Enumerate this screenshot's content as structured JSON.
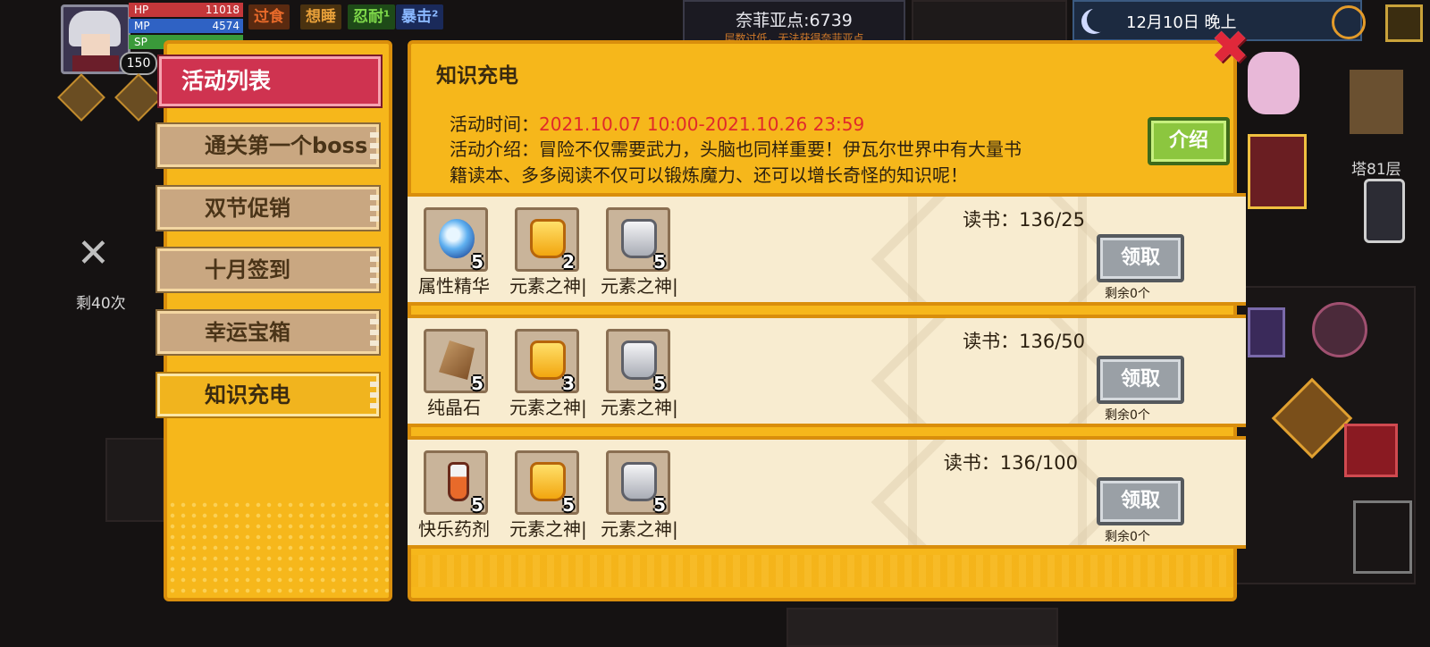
{
  "hud": {
    "level": "150",
    "stats": [
      {
        "label": "HP",
        "value": "11018",
        "color": "#d43a3a"
      },
      {
        "label": "MP",
        "value": "4574",
        "color": "#2f6fd6"
      },
      {
        "label": "SP",
        "value": "",
        "color": "#3aa53a"
      }
    ],
    "status_tags": [
      {
        "label": "过食",
        "color": "#e05a2a",
        "bg": "#5a2a10"
      },
      {
        "label": "想睡",
        "color": "#e9a13a",
        "bg": "#4a3210"
      },
      {
        "label": "忍耐¹",
        "color": "#7fd94a",
        "bg": "#1e4a18"
      },
      {
        "label": "暴击²",
        "color": "#8ab8ff",
        "bg": "#1a2a5a"
      }
    ],
    "nephi_points": "奈菲亚点:6739",
    "nephi_notice": "层数过低，无法获得奈菲亚点",
    "date": "12月10日  晚上",
    "floor": "塔81层",
    "remaining_uses": "剩40次"
  },
  "sidebar": {
    "header": "活动列表",
    "tabs": [
      {
        "label": "通关第一个boss"
      },
      {
        "label": "双节促销"
      },
      {
        "label": "十月签到"
      },
      {
        "label": "幸运宝箱"
      },
      {
        "label": "知识充电"
      }
    ]
  },
  "event": {
    "title": "知识充电",
    "time_label": "活动时间：",
    "time_value": "2021.10.07 10:00-2021.10.26 23:59",
    "intro_line1": "活动介绍：冒险不仅需要武力，头脑也同样重要！伊瓦尔世界中有大量书",
    "intro_line2": "籍读本、多多阅读不仅可以锻炼魔力、还可以增长奇怪的知识呢！",
    "intro_button": "介绍"
  },
  "rewards": [
    {
      "progress": "读书：136/25",
      "claim": "领取",
      "remaining": "剩余0个",
      "items": [
        {
          "name": "属性精华",
          "qty": "5",
          "icon": "orb"
        },
        {
          "name": "元素之神|",
          "qty": "2",
          "icon": "gold"
        },
        {
          "name": "元素之神|",
          "qty": "5",
          "icon": "silver"
        }
      ]
    },
    {
      "progress": "读书：136/50",
      "claim": "领取",
      "remaining": "剩余0个",
      "items": [
        {
          "name": "纯晶石",
          "qty": "5",
          "icon": "rock"
        },
        {
          "name": "元素之神|",
          "qty": "3",
          "icon": "gold"
        },
        {
          "name": "元素之神|",
          "qty": "5",
          "icon": "silver"
        }
      ]
    },
    {
      "progress": "读书：136/100",
      "claim": "领取",
      "remaining": "剩余0个",
      "items": [
        {
          "name": "快乐药剂",
          "qty": "5",
          "icon": "potion"
        },
        {
          "name": "元素之神|",
          "qty": "5",
          "icon": "gold"
        },
        {
          "name": "元素之神|",
          "qty": "5",
          "icon": "silver"
        }
      ]
    }
  ]
}
